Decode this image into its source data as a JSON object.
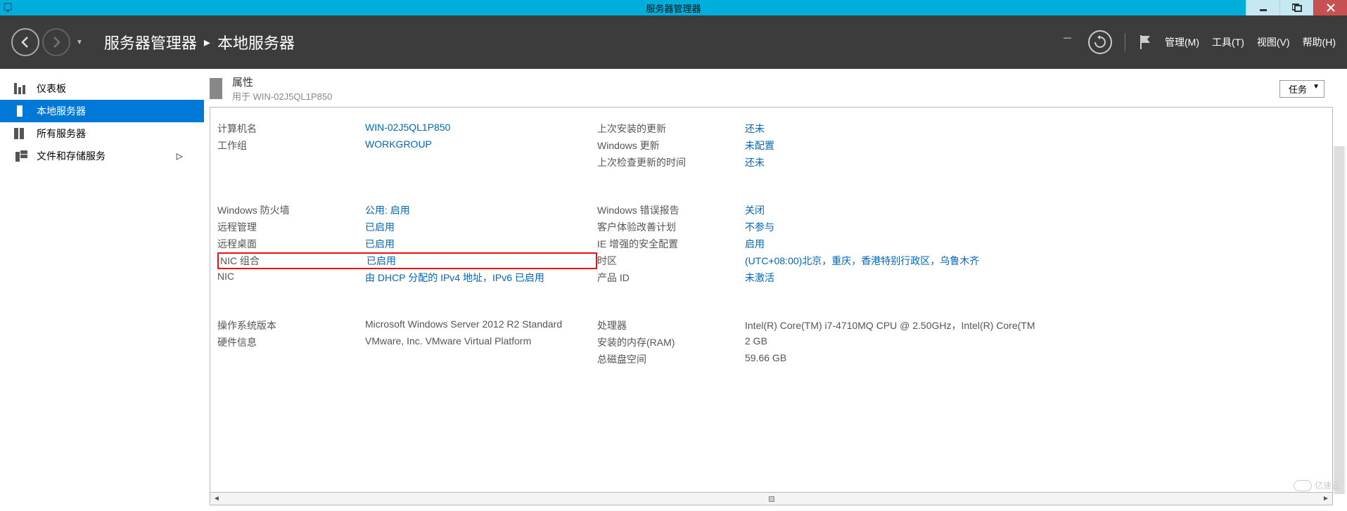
{
  "titlebar": {
    "title": "服务器管理器"
  },
  "header": {
    "breadcrumb": {
      "root": "服务器管理器",
      "current": "本地服务器"
    },
    "menus": {
      "manage": "管理(M)",
      "tools": "工具(T)",
      "view": "视图(V)",
      "help": "帮助(H)"
    }
  },
  "sidebar": {
    "items": [
      {
        "label": "仪表板"
      },
      {
        "label": "本地服务器"
      },
      {
        "label": "所有服务器"
      },
      {
        "label": "文件和存储服务"
      }
    ]
  },
  "panel": {
    "title": "属性",
    "subtitle": "用于 WIN-02J5QL1P850",
    "tasks_label": "任务"
  },
  "props": {
    "left": [
      {
        "label": "计算机名",
        "value": "WIN-02J5QL1P850",
        "link": true
      },
      {
        "label": "工作组",
        "value": "WORKGROUP",
        "link": true
      },
      {
        "label": "",
        "value": ""
      }
    ],
    "right": [
      {
        "label": "上次安装的更新",
        "value": "还未",
        "link": true
      },
      {
        "label": "Windows 更新",
        "value": "未配置",
        "link": true
      },
      {
        "label": "上次检查更新的时间",
        "value": "还未",
        "link": true
      }
    ],
    "left2": [
      {
        "label": "Windows 防火墙",
        "value": "公用: 启用",
        "link": true
      },
      {
        "label": "远程管理",
        "value": "已启用",
        "link": true
      },
      {
        "label": "远程桌面",
        "value": "已启用",
        "link": true
      },
      {
        "label": "NIC 组合",
        "value": "已启用",
        "link": true,
        "highlight": true
      },
      {
        "label": "NIC",
        "value": "由 DHCP 分配的 IPv4 地址，IPv6 已启用",
        "link": true
      }
    ],
    "right2": [
      {
        "label": "Windows 错误报告",
        "value": "关闭",
        "link": true
      },
      {
        "label": "客户体验改善计划",
        "value": "不参与",
        "link": true
      },
      {
        "label": "IE 增强的安全配置",
        "value": "启用",
        "link": true
      },
      {
        "label": "时区",
        "value": "(UTC+08:00)北京，重庆，香港特别行政区，乌鲁木齐",
        "link": true
      },
      {
        "label": "产品 ID",
        "value": "未激活",
        "link": true
      }
    ],
    "left3": [
      {
        "label": "操作系统版本",
        "value": "Microsoft Windows Server 2012 R2 Standard",
        "link": false
      },
      {
        "label": "硬件信息",
        "value": "VMware, Inc. VMware Virtual Platform",
        "link": false
      },
      {
        "label": "",
        "value": ""
      }
    ],
    "right3": [
      {
        "label": "处理器",
        "value": "Intel(R) Core(TM) i7-4710MQ CPU @ 2.50GHz，Intel(R) Core(TM",
        "link": false
      },
      {
        "label": "安装的内存(RAM)",
        "value": "2 GB",
        "link": false
      },
      {
        "label": "总磁盘空间",
        "value": "59.66 GB",
        "link": false
      }
    ]
  },
  "watermark": "亿速云"
}
